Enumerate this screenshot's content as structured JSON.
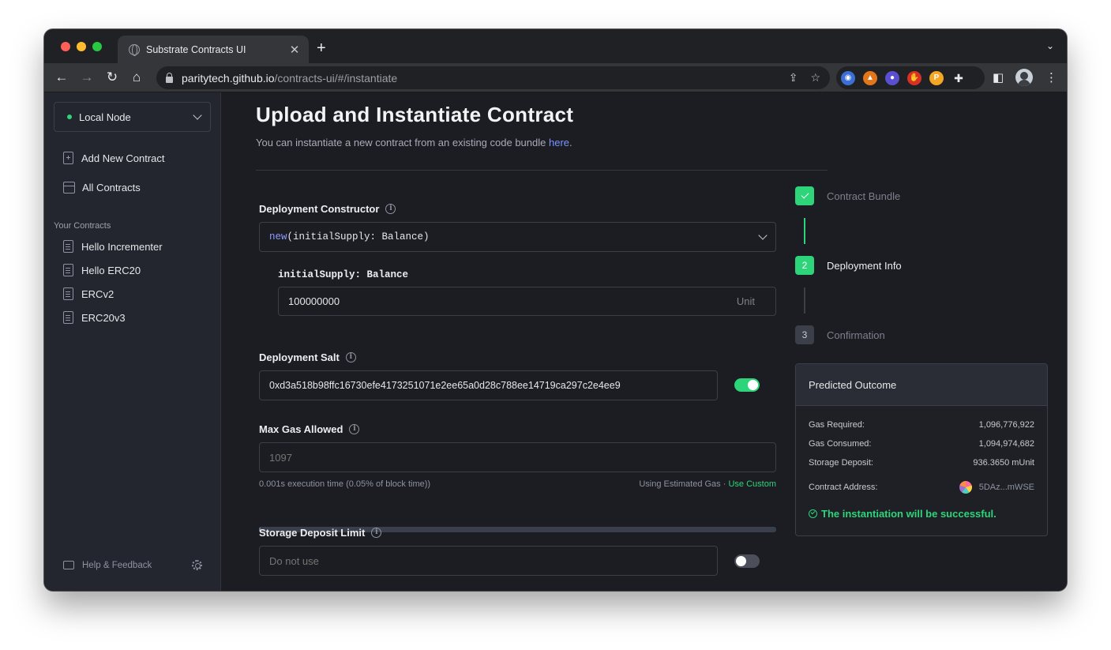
{
  "browser": {
    "tab_title": "Substrate Contracts UI",
    "url_host": "paritytech.github.io",
    "url_path": "/contracts-ui/#/instantiate"
  },
  "sidebar": {
    "node_selector": "Local Node",
    "nav": [
      {
        "label": "Add New Contract"
      },
      {
        "label": "All Contracts"
      }
    ],
    "section_title": "Your Contracts",
    "contracts": [
      {
        "label": "Hello Incrementer"
      },
      {
        "label": "Hello ERC20"
      },
      {
        "label": "ERCv2"
      },
      {
        "label": "ERC20v3"
      }
    ],
    "footer_label": "Help & Feedback"
  },
  "main": {
    "title": "Upload and Instantiate Contract",
    "subtitle": "You can instantiate a new contract from an existing code bundle ",
    "subtitle_link": "here",
    "subtitle_end": ".",
    "constructor": {
      "label": "Deployment Constructor",
      "keyword": "new",
      "signature": "(initialSupply: Balance)",
      "param_label": "initialSupply: Balance",
      "param_value": "100000000",
      "param_unit": "Unit"
    },
    "salt": {
      "label": "Deployment Salt",
      "value": "0xd3a518b98ffc16730efe4173251071e2ee65a0d28c788ee14719ca297c2e4ee9",
      "enabled": true
    },
    "gas": {
      "label": "Max Gas Allowed",
      "placeholder": "1097",
      "exec_time": "0.001s execution time (0.05% of block time))",
      "estimated": "Using Estimated Gas",
      "separator": "·",
      "custom_link": "Use Custom",
      "progress_fraction": 0.003
    },
    "storage": {
      "label": "Storage Deposit Limit",
      "placeholder": "Do not use",
      "enabled": false
    }
  },
  "steps": [
    {
      "num": "",
      "label": "Contract Bundle",
      "state": "done"
    },
    {
      "num": "2",
      "label": "Deployment Info",
      "state": "active"
    },
    {
      "num": "3",
      "label": "Confirmation",
      "state": "pending"
    }
  ],
  "outcome": {
    "title": "Predicted Outcome",
    "rows": [
      {
        "label": "Gas Required:",
        "value": "1,096,776,922"
      },
      {
        "label": "Gas Consumed:",
        "value": "1,094,974,682"
      },
      {
        "label": "Storage Deposit:",
        "value": "936.3650 mUnit"
      }
    ],
    "address_label": "Contract Address:",
    "address_value": "5DAz...mWSE",
    "success": "The instantiation will be successful."
  },
  "colors": {
    "accent_green": "#2ed47a",
    "link_blue": "#7d92ff",
    "background": "#1b1d22",
    "sidebar": "#23262e"
  }
}
